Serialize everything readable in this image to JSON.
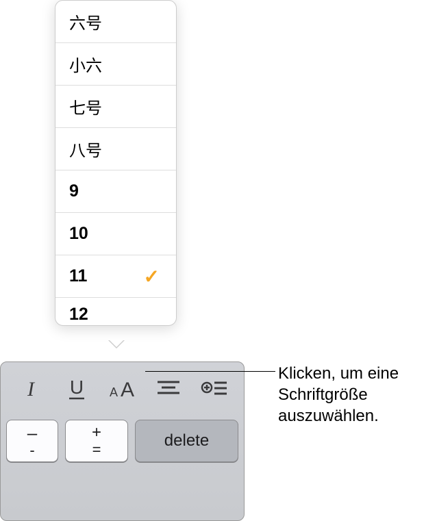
{
  "sizes": {
    "items": [
      {
        "label": "六号",
        "selected": false,
        "numeric": false
      },
      {
        "label": "小六",
        "selected": false,
        "numeric": false
      },
      {
        "label": "七号",
        "selected": false,
        "numeric": false
      },
      {
        "label": "八号",
        "selected": false,
        "numeric": false
      },
      {
        "label": "9",
        "selected": false,
        "numeric": true
      },
      {
        "label": "10",
        "selected": false,
        "numeric": true
      },
      {
        "label": "11",
        "selected": true,
        "numeric": true
      },
      {
        "label": "12",
        "selected": false,
        "numeric": true
      }
    ]
  },
  "keys": {
    "minus_top": "–",
    "minus_bot": "-",
    "plus_top": "+",
    "plus_bot": "=",
    "delete": "delete"
  },
  "callout": {
    "text": "Klicken, um eine Schriftgröße auszuwählen."
  }
}
